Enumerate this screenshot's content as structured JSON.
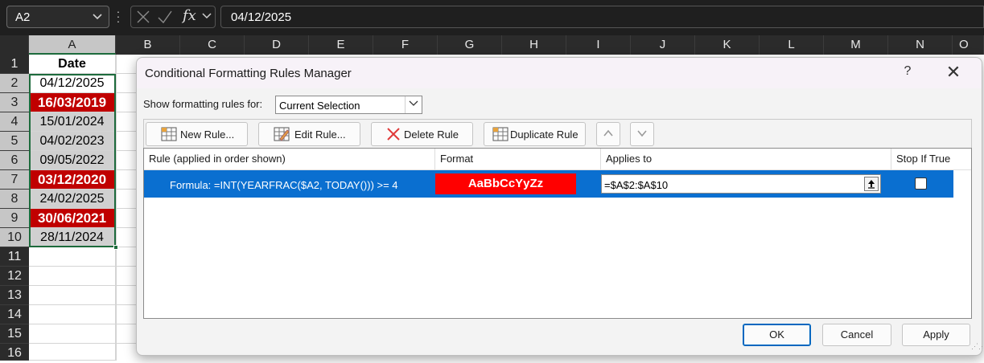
{
  "formula_bar": {
    "name_box": "A2",
    "fx": "fx",
    "formula": "04/12/2025"
  },
  "sheet": {
    "columns": [
      "A",
      "B",
      "C",
      "D",
      "E",
      "F",
      "G",
      "H",
      "I",
      "J",
      "K",
      "L",
      "M",
      "N",
      "O"
    ],
    "rows": [
      "1",
      "2",
      "3",
      "4",
      "5",
      "6",
      "7",
      "8",
      "9",
      "10",
      "11",
      "12",
      "13",
      "14",
      "15",
      "16"
    ],
    "cells": [
      "Date",
      "04/12/2025",
      "16/03/2019",
      "15/01/2024",
      "04/02/2023",
      "09/05/2022",
      "03/12/2020",
      "24/02/2025",
      "30/06/2021",
      "28/11/2024"
    ]
  },
  "dialog": {
    "title": "Conditional Formatting Rules Manager",
    "help": "?",
    "close": "✕",
    "show_label": "Show formatting rules for:",
    "show_value": "Current Selection",
    "buttons": {
      "new_rule": "New Rule...",
      "edit_rule": "Edit Rule...",
      "delete_rule": "Delete Rule",
      "duplicate_rule": "Duplicate Rule"
    },
    "columns": {
      "rule": "Rule (applied in order shown)",
      "format": "Format",
      "applies_to": "Applies to",
      "stop_if_true": "Stop If True"
    },
    "rule_row": {
      "rule": "Formula: =INT(YEARFRAC($A2, TODAY())) >= 4",
      "format_preview": "AaBbCcYyZz",
      "applies_to": "=$A$2:$A$10",
      "stop_if_true": false
    },
    "ok": "OK",
    "cancel": "Cancel",
    "apply": "Apply"
  },
  "colors": {
    "highlight_fill": "#c00000",
    "format_preview_fill": "#ff0000",
    "selected_row": "#0a6fd0",
    "selection_border": "#1d6b3c"
  }
}
